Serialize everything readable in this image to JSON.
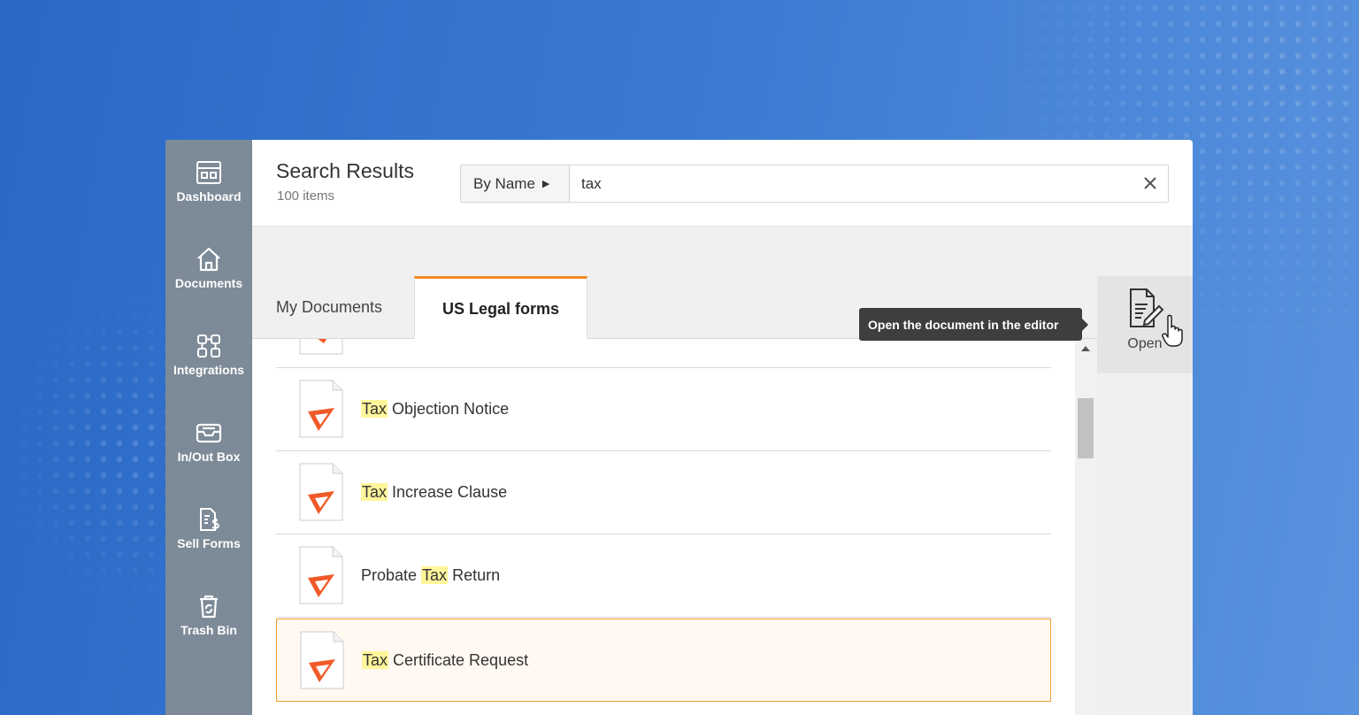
{
  "sidebar": {
    "items": [
      {
        "label": "Dashboard",
        "icon": "dashboard-icon"
      },
      {
        "label": "Documents",
        "icon": "home-icon"
      },
      {
        "label": "Integrations",
        "icon": "integrations-icon"
      },
      {
        "label": "In/Out Box",
        "icon": "inbox-icon"
      },
      {
        "label": "Sell Forms",
        "icon": "sell-forms-icon"
      },
      {
        "label": "Trash Bin",
        "icon": "trash-icon"
      }
    ]
  },
  "header": {
    "title": "Search Results",
    "count": "100 items"
  },
  "search": {
    "mode_label": "By Name",
    "value": "tax"
  },
  "tabs": [
    {
      "label": "My Documents",
      "active": false
    },
    {
      "label": "US Legal forms",
      "active": true
    }
  ],
  "results": [
    {
      "before": "",
      "highlight": "Tax",
      "after": " Objection Notice"
    },
    {
      "before": "",
      "highlight": "Tax",
      "after": " Increase Clause"
    },
    {
      "before": "Probate ",
      "highlight": "Tax",
      "after": " Return"
    },
    {
      "before": "",
      "highlight": "Tax",
      "after": " Certificate Request",
      "selected": true
    }
  ],
  "actions": {
    "open_label": "Open",
    "open_tooltip": "Open the document in the editor"
  },
  "colors": {
    "accent": "#f08a24",
    "sidebar": "#7d8a97",
    "highlight": "#fff59a",
    "brand_logo": "#f05a28"
  }
}
